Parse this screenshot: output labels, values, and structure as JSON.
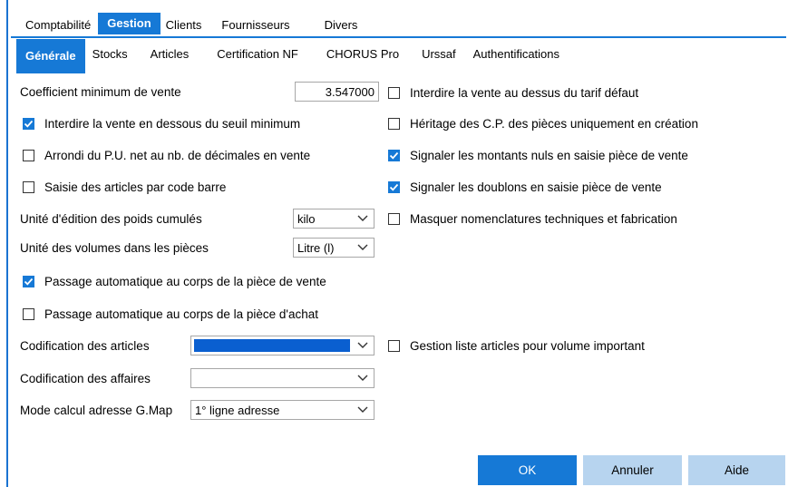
{
  "tabs_top": [
    "Comptabilité",
    "Gestion",
    "Clients",
    "Fournisseurs",
    "Divers"
  ],
  "tabs_sub": [
    "Générale",
    "Stocks",
    "Articles",
    "Certification NF",
    "CHORUS Pro",
    "Urssaf",
    "Authentifications"
  ],
  "colors": {
    "accent": "#1679d6",
    "secondary_button": "#b7d4ef"
  },
  "left": {
    "coef_label": "Coefficient minimum de vente",
    "coef_value": "3.547000",
    "cb_seuil": "Interdire la vente en dessous du seuil minimum",
    "cb_arrondi": "Arrondi du P.U. net au nb. de décimales en vente",
    "cb_code_barre": "Saisie des articles par code barre",
    "poids_label": "Unité d'édition des poids cumulés",
    "poids_value": "kilo",
    "volumes_label": "Unité des volumes dans les pièces",
    "volumes_value": "Litre (l)",
    "cb_passage_vente": "Passage automatique au corps de la pièce de vente",
    "cb_passage_achat": "Passage automatique au corps de la pièce d'achat",
    "codif_articles_label": "Codification des articles",
    "codif_articles_value": "",
    "codif_affaires_label": "Codification des affaires",
    "codif_affaires_value": "",
    "mode_calcul_label": "Mode calcul adresse G.Map",
    "mode_calcul_value": "1° ligne adresse"
  },
  "right": {
    "cb_interdire_dessus": "Interdire la vente au dessus du tarif défaut",
    "cb_heritage": "Héritage des C.P. des pièces uniquement en création",
    "cb_montants_nuls": "Signaler les montants nuls en saisie pièce de vente",
    "cb_doublons": "Signaler les doublons en saisie pièce de vente",
    "cb_nomenclatures": "Masquer nomenclatures techniques et fabrication",
    "cb_gestion_liste": "Gestion liste articles pour volume important"
  },
  "checked": {
    "cb_seuil": true,
    "cb_arrondi": false,
    "cb_code_barre": false,
    "cb_passage_vente": true,
    "cb_passage_achat": false,
    "cb_interdire_dessus": false,
    "cb_heritage": false,
    "cb_montants_nuls": true,
    "cb_doublons": true,
    "cb_nomenclatures": false,
    "cb_gestion_liste": false
  },
  "buttons": {
    "ok": "OK",
    "cancel": "Annuler",
    "help": "Aide"
  }
}
